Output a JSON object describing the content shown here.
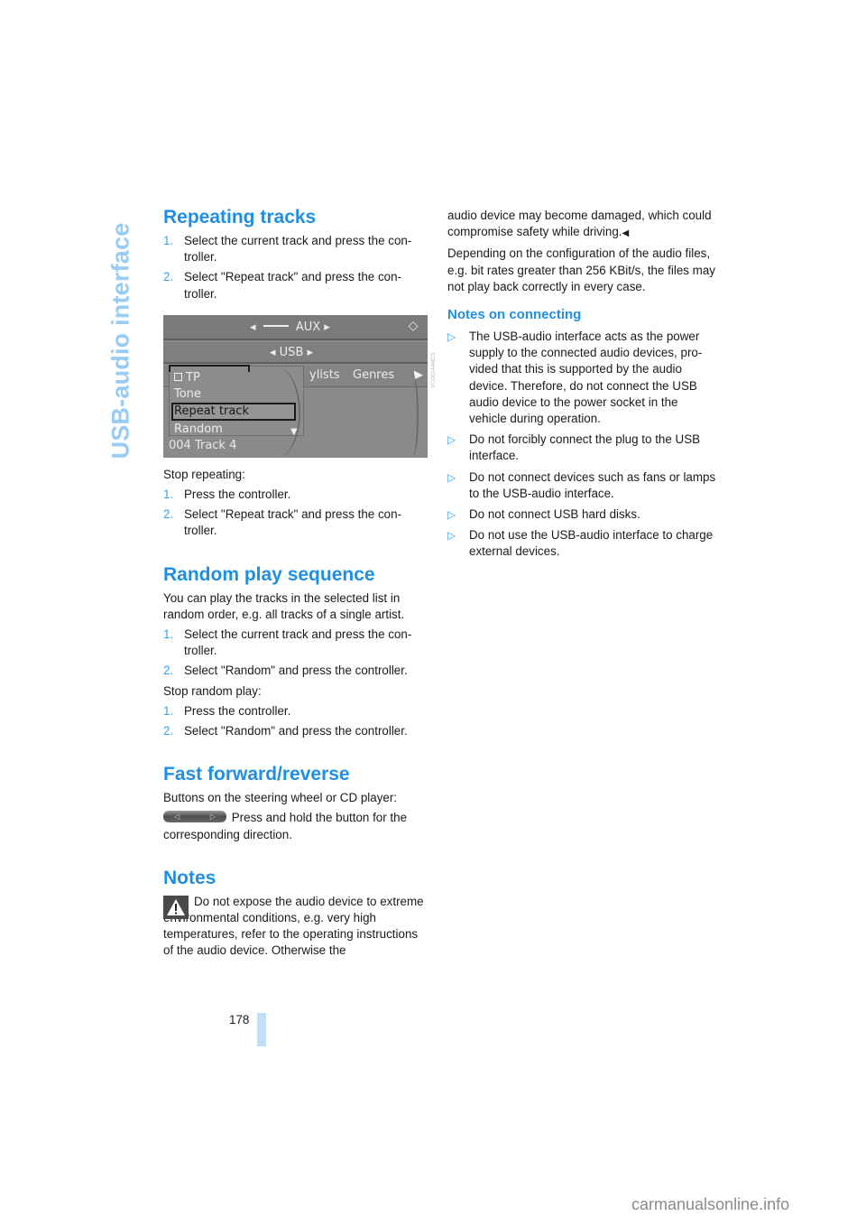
{
  "chapter_title": "USB-audio interface",
  "page_number": "178",
  "watermark": "carmanualsonline.info",
  "colors": {
    "heading": "#1e8fe3",
    "side_title": "#99ccf2",
    "page_bar": "#c1dff8"
  },
  "repeating": {
    "heading": "Repeating tracks",
    "steps": [
      {
        "num": "1.",
        "text": "Select the current track and press the con-troller."
      },
      {
        "num": "2.",
        "text": "Select \"Repeat track\" and press the con-troller."
      }
    ],
    "screen": {
      "top_source": "AUX",
      "top_arrows": {
        "left": "◂",
        "right": "▸"
      },
      "second_source": "USB",
      "tabs_visible": [
        "ylists",
        "Genres"
      ],
      "tab_more": "▶",
      "menu_items": [
        {
          "label": "TP",
          "has_checkbox": true,
          "checked": false
        },
        {
          "label": "Tone"
        },
        {
          "label": "Repeat track",
          "selected": true
        },
        {
          "label": "Random"
        }
      ],
      "current_track": "004 Track 4",
      "image_code": "VCO0144MCS"
    },
    "stop_label": "Stop repeating:",
    "stop_steps": [
      {
        "num": "1.",
        "text": "Press the controller."
      },
      {
        "num": "2.",
        "text": "Select \"Repeat track\" and press the con-troller."
      }
    ]
  },
  "random": {
    "heading": "Random play sequence",
    "intro": "You can play the tracks in the selected list in random order, e.g. all tracks of a single artist.",
    "steps": [
      {
        "num": "1.",
        "text": "Select the current track and press the con-troller."
      },
      {
        "num": "2.",
        "text": "Select \"Random\" and press the controller."
      }
    ],
    "stop_label": "Stop random play:",
    "stop_steps": [
      {
        "num": "1.",
        "text": "Press the controller."
      },
      {
        "num": "2.",
        "text": "Select \"Random\" and press the controller."
      }
    ]
  },
  "fast_forward": {
    "heading": "Fast forward/reverse",
    "intro": "Buttons on the steering wheel or CD player:",
    "button_glyphs": {
      "left": "◁",
      "right": "▷"
    },
    "instruction": "Press and hold the button for the corresponding direction."
  },
  "notes": {
    "heading": "Notes",
    "warning_text_part1": "Do not expose the audio device to extreme environmental conditions, e.g. very high temperatures, refer to the operating instructions of the audio device. Otherwise the",
    "warning_text_part2": "audio device may become damaged, which could compromise safety while driving.",
    "end_mark": "◀",
    "config_note": "Depending on the configuration of the audio files, e.g. bit rates greater than 256 KBit/s, the files may not play back correctly in every case."
  },
  "connecting": {
    "heading": "Notes on connecting",
    "bullet_mark": "▷",
    "bullets": [
      "The USB-audio interface acts as the power supply to the connected audio devices, pro-vided that this is supported by the audio device. Therefore, do not connect the USB audio device to the power socket in the vehicle during operation.",
      "Do not forcibly connect the plug to the USB interface.",
      "Do not connect devices such as fans or lamps to the USB-audio interface.",
      "Do not connect USB hard disks.",
      "Do not use the USB-audio interface to charge external devices."
    ]
  }
}
